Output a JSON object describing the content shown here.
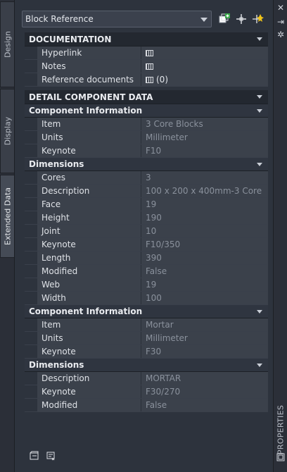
{
  "tabs": [
    {
      "label": "Design"
    },
    {
      "label": "Display"
    },
    {
      "label": "Extended Data"
    }
  ],
  "selector": {
    "value": "Block Reference"
  },
  "right_strip": {
    "label": "PROPERTIES"
  },
  "documentation": {
    "header": "DOCUMENTATION",
    "rows": [
      {
        "label": "Hyperlink",
        "icon": "table-icon"
      },
      {
        "label": "Notes",
        "icon": "table-icon"
      },
      {
        "label": "Reference documents",
        "icon": "table-icon",
        "value": "(0)"
      }
    ]
  },
  "detail": {
    "header": "DETAIL COMPONENT DATA",
    "comp1": {
      "header": "Component Information",
      "rows": [
        {
          "label": "Item",
          "value": "3 Core Blocks"
        },
        {
          "label": "Units",
          "value": "Millimeter"
        },
        {
          "label": "Keynote",
          "value": "F10"
        }
      ]
    },
    "dim1": {
      "header": "Dimensions",
      "rows": [
        {
          "label": "Cores",
          "value": "3"
        },
        {
          "label": "Description",
          "value": "100 x 200 x 400mm-3 Core"
        },
        {
          "label": "Face",
          "value": "19"
        },
        {
          "label": "Height",
          "value": "190"
        },
        {
          "label": "Joint",
          "value": "10"
        },
        {
          "label": "Keynote",
          "value": "F10/350"
        },
        {
          "label": "Length",
          "value": "390"
        },
        {
          "label": "Modified",
          "value": "False"
        },
        {
          "label": "Web",
          "value": "19"
        },
        {
          "label": "Width",
          "value": "100"
        }
      ]
    },
    "comp2": {
      "header": "Component Information",
      "rows": [
        {
          "label": "Item",
          "value": "Mortar"
        },
        {
          "label": "Units",
          "value": "Millimeter"
        },
        {
          "label": "Keynote",
          "value": "F30"
        }
      ]
    },
    "dim2": {
      "header": "Dimensions",
      "rows": [
        {
          "label": "Description",
          "value": "MORTAR"
        },
        {
          "label": "Keynote",
          "value": "F30/270"
        },
        {
          "label": "Modified",
          "value": "False"
        }
      ]
    }
  }
}
